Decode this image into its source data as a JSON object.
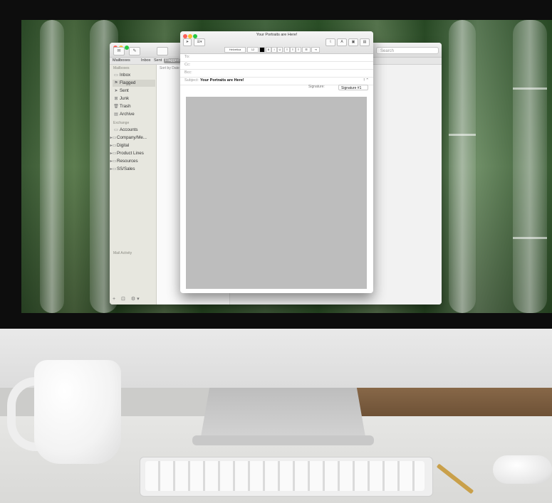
{
  "main_window": {
    "search_placeholder": "Search",
    "favorites": [
      "Mailboxes",
      "Inbox",
      "Sent",
      "Flagged"
    ],
    "sidebar": {
      "mailboxes_header": "Mailboxes",
      "mailboxes": [
        {
          "label": "Inbox",
          "icon": "inbox-icon",
          "selected": false
        },
        {
          "label": "Flagged",
          "icon": "flag-icon",
          "selected": true
        },
        {
          "label": "Sent",
          "icon": "paper-plane-icon",
          "selected": false
        },
        {
          "label": "Junk",
          "icon": "junk-icon",
          "selected": false
        },
        {
          "label": "Trash",
          "icon": "trash-icon",
          "selected": false
        },
        {
          "label": "Archive",
          "icon": "archive-icon",
          "selected": false
        }
      ],
      "exchange_header": "Exchange",
      "exchange_folders": [
        {
          "label": "Accounts"
        },
        {
          "label": "Company/Me..."
        },
        {
          "label": "Digital"
        },
        {
          "label": "Product Lines"
        },
        {
          "label": "Resources"
        },
        {
          "label": "SS/Sales"
        }
      ],
      "activity_label": "Mail Activity",
      "footer_plus": "+",
      "footer_gear": "⚙ ▾"
    },
    "list": {
      "sort_label": "Sort by Date"
    }
  },
  "compose_window": {
    "title": "Your Portraits are Here!",
    "font_name": "Helvetica",
    "font_size": "12",
    "to_label": "To:",
    "cc_label": "Cc:",
    "bcc_label": "Bcc:",
    "subject_label": "Subject:",
    "subject_value": "Your Portraits are Here!",
    "signature_label": "Signature:",
    "signature_value": "Signature #1",
    "body_fill_color": "#bdbdbd"
  }
}
